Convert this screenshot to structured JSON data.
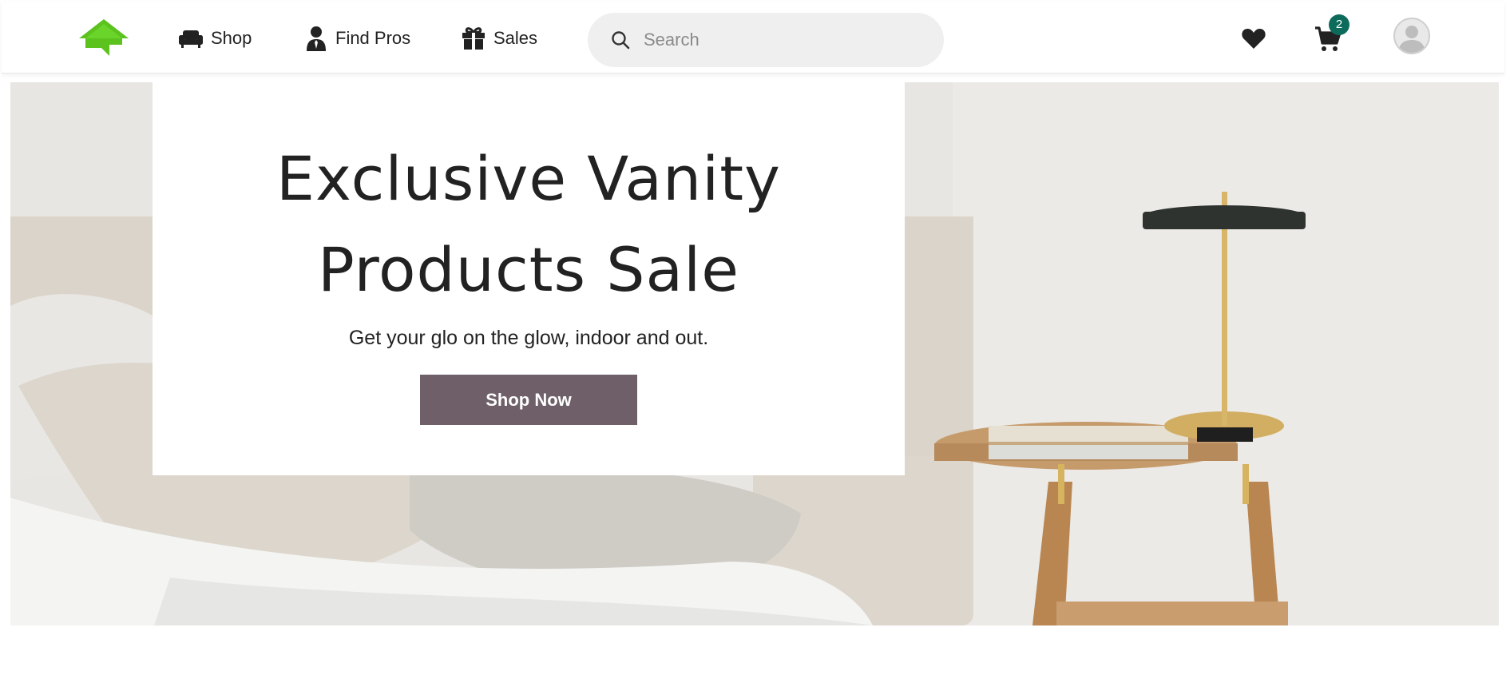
{
  "header": {
    "logo_icon": "house-logo-icon",
    "nav": [
      {
        "label": "Shop",
        "icon": "sofa-icon"
      },
      {
        "label": "Find Pros",
        "icon": "person-icon"
      },
      {
        "label": "Sales",
        "icon": "gift-icon"
      }
    ],
    "search": {
      "placeholder": "Search",
      "value": "",
      "icon": "search-icon"
    },
    "wishlist_icon": "heart-icon",
    "cart": {
      "icon": "cart-icon",
      "count": "2"
    },
    "account_icon": "avatar-icon"
  },
  "hero": {
    "title_line1": "Exclusive Vanity",
    "title_line2": "Products Sale",
    "subtitle": "Get your glo on the glow, indoor and out.",
    "cta_label": "Shop Now"
  },
  "colors": {
    "brand_green": "#5cc21e",
    "cta_background": "#6e5f68",
    "badge": "#0d6b5c"
  }
}
